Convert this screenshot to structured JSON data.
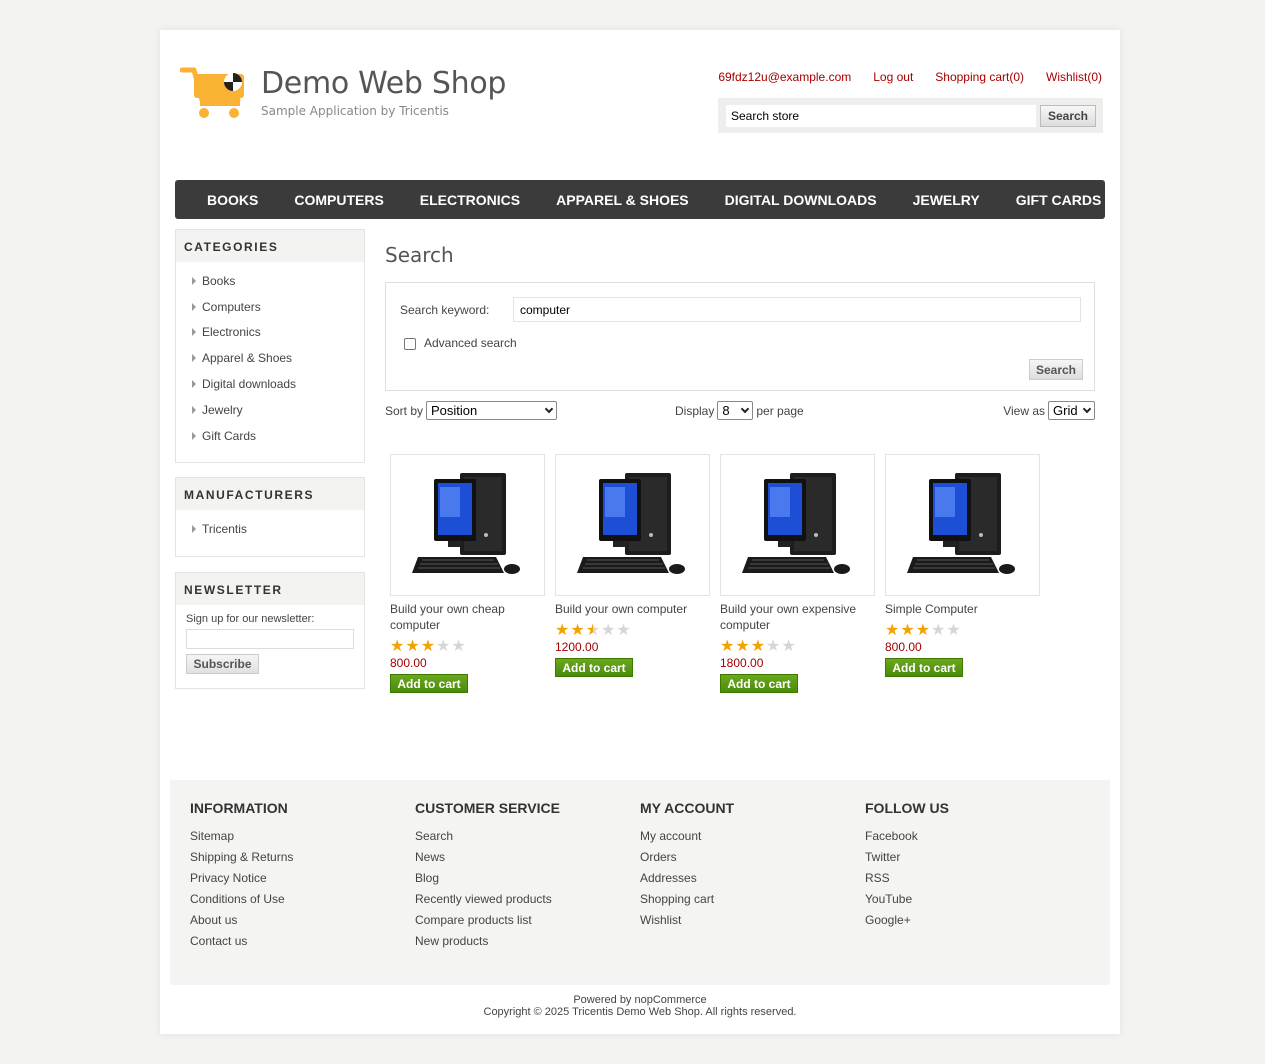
{
  "header": {
    "logo_title": "Demo Web Shop",
    "logo_subtitle": "Sample Application by Tricentis",
    "links": {
      "account": "69fdz12u@example.com",
      "logout": "Log out",
      "cart": "Shopping cart(0)",
      "wishlist": "Wishlist(0)"
    },
    "search": {
      "value": "Search store",
      "button": "Search"
    }
  },
  "menu": [
    "BOOKS",
    "COMPUTERS",
    "ELECTRONICS",
    "APPAREL & SHOES",
    "DIGITAL DOWNLOADS",
    "JEWELRY",
    "GIFT CARDS"
  ],
  "categories": {
    "title": "CATEGORIES",
    "items": [
      "Books",
      "Computers",
      "Electronics",
      "Apparel & Shoes",
      "Digital downloads",
      "Jewelry",
      "Gift Cards"
    ]
  },
  "manufacturers": {
    "title": "MANUFACTURERS",
    "items": [
      "Tricentis"
    ]
  },
  "newsletter": {
    "title": "NEWSLETTER",
    "label": "Sign up for our newsletter:",
    "button": "Subscribe"
  },
  "search_page": {
    "title": "Search",
    "keyword_label": "Search keyword:",
    "keyword_value": "computer",
    "advanced_label": "Advanced search",
    "advanced_checked": false,
    "button": "Search",
    "sort_label": "Sort by",
    "sort_value": "Position",
    "display_label": "Display",
    "display_value": "8",
    "per_page": "per page",
    "view_label": "View as",
    "view_value": "Grid"
  },
  "products": [
    {
      "title": "Build your own cheap computer",
      "rating": 3,
      "price": "800.00",
      "button": "Add to cart"
    },
    {
      "title": "Build your own computer",
      "rating": 2.5,
      "price": "1200.00",
      "button": "Add to cart"
    },
    {
      "title": "Build your own expensive computer",
      "rating": 3,
      "price": "1800.00",
      "button": "Add to cart"
    },
    {
      "title": "Simple Computer",
      "rating": 3,
      "price": "800.00",
      "button": "Add to cart"
    }
  ],
  "footer": {
    "columns": [
      {
        "title": "INFORMATION",
        "links": [
          "Sitemap",
          "Shipping & Returns",
          "Privacy Notice",
          "Conditions of Use",
          "About us",
          "Contact us"
        ]
      },
      {
        "title": "CUSTOMER SERVICE",
        "links": [
          "Search",
          "News",
          "Blog",
          "Recently viewed products",
          "Compare products list",
          "New products"
        ]
      },
      {
        "title": "MY ACCOUNT",
        "links": [
          "My account",
          "Orders",
          "Addresses",
          "Shopping cart",
          "Wishlist"
        ]
      },
      {
        "title": "FOLLOW US",
        "links": [
          "Facebook",
          "Twitter",
          "RSS",
          "YouTube",
          "Google+"
        ]
      }
    ],
    "powered": "Powered by nopCommerce",
    "copyright": "Copyright © 2025 Tricentis Demo Web Shop. All rights reserved."
  },
  "colors": {
    "link_red": "#a60000",
    "menu_bg": "#3b3b3b",
    "logo_orange": "#f9b233",
    "add_to_cart_green": "#5b9a14",
    "star": "#f3a200"
  }
}
